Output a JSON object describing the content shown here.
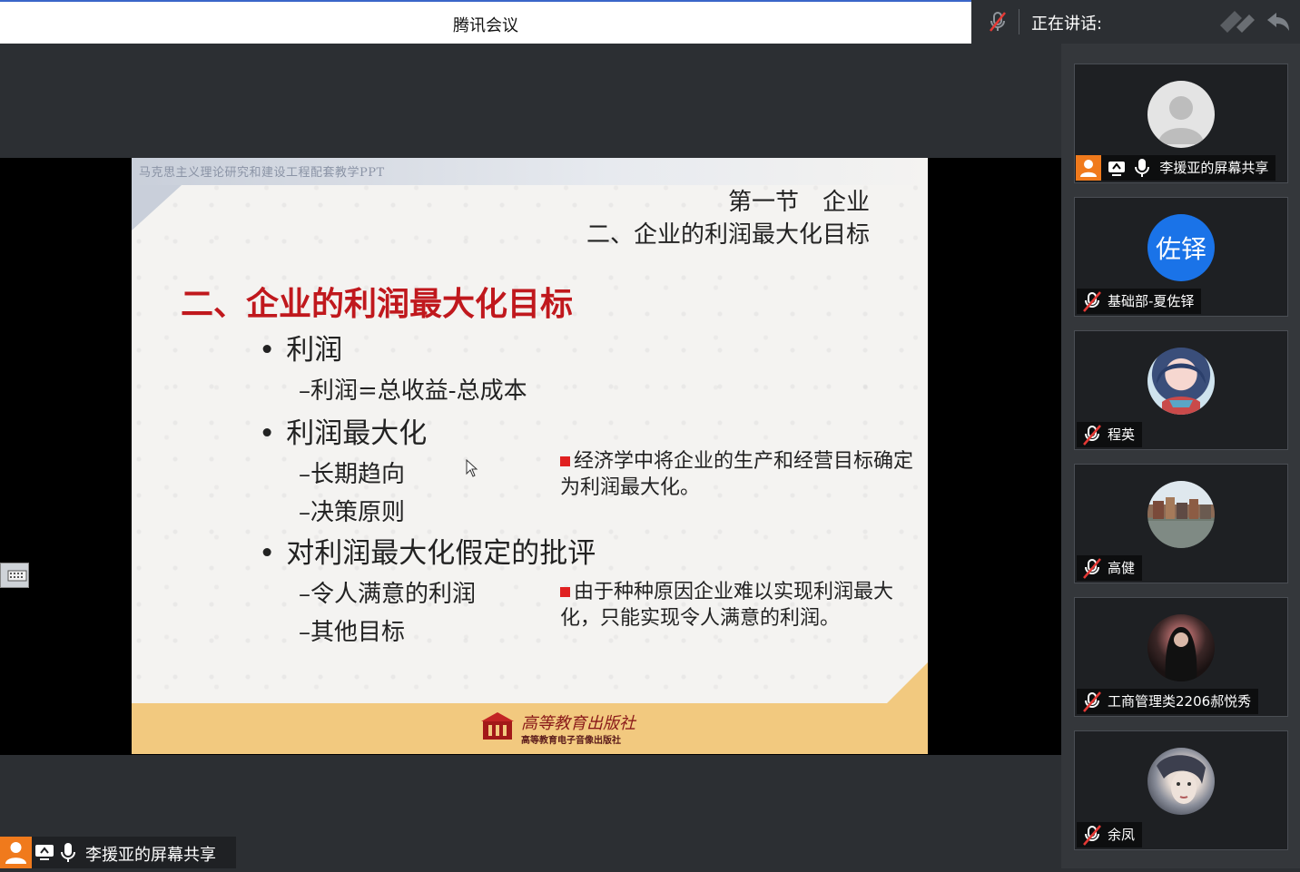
{
  "window": {
    "title": "腾讯会议"
  },
  "speaking": {
    "label": "正在讲话:"
  },
  "slide": {
    "header_small": "马克思主义理论研究和建设工程配套教学PPT",
    "header_line1": "第一节　企业",
    "header_line2": "二、企业的利润最大化目标",
    "main_title": "二、企业的利润最大化目标",
    "bullets": [
      {
        "text": "利润",
        "subs": [
          "–利润=总收益-总成本"
        ]
      },
      {
        "text": "利润最大化",
        "subs": [
          "–长期趋向",
          "–决策原则"
        ]
      },
      {
        "text": "对利润最大化假定的批评",
        "subs": [
          "–令人满意的利润",
          "–其他目标"
        ]
      }
    ],
    "note1": "经济学中将企业的生产和经营目标确定为利润最大化。",
    "note2": "由于种种原因企业难以实现利润最大化，只能实现令人满意的利润。",
    "publisher_line1": "高等教育出版社",
    "publisher_line2": "高等教育电子音像出版社"
  },
  "share_tag": {
    "label": "李援亚的屏幕共享"
  },
  "participants": [
    {
      "name": "李援亚的屏幕共享",
      "avatar": "default-person",
      "sharing": true
    },
    {
      "name": "基础部-夏佐铎",
      "avatar_text": "佐铎",
      "color": "#1a73e8"
    },
    {
      "name": "程英",
      "avatar": "anime-girl"
    },
    {
      "name": "高健",
      "avatar": "city-photo"
    },
    {
      "name": "工商管理类2206郝悦秀",
      "avatar": "dark-hair"
    },
    {
      "name": "余凤",
      "avatar": "fantasy-face"
    }
  ],
  "colors": {
    "accent_orange": "#f07a1c",
    "title_red": "#c0181d",
    "mic_off_red": "#e53935"
  }
}
